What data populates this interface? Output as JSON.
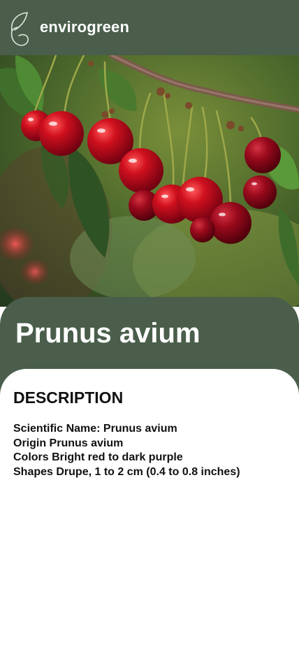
{
  "header": {
    "app_name": "envirogreen",
    "logo_icon": "leaf-g-icon",
    "background": "#4a5e4b"
  },
  "hero": {
    "icon": "cherry-photo",
    "subject": "cherries"
  },
  "plant": {
    "title": "Prunus avium"
  },
  "description": {
    "heading": "DESCRIPTION",
    "scientific_name": "Scientific Name: Prunus avium",
    "origin": "Origin Prunus avium",
    "colors": "Colors Bright red to dark purple",
    "shapes": "Shapes Drupe, 1 to 2 cm (0.4 to 0.8 inches)"
  }
}
